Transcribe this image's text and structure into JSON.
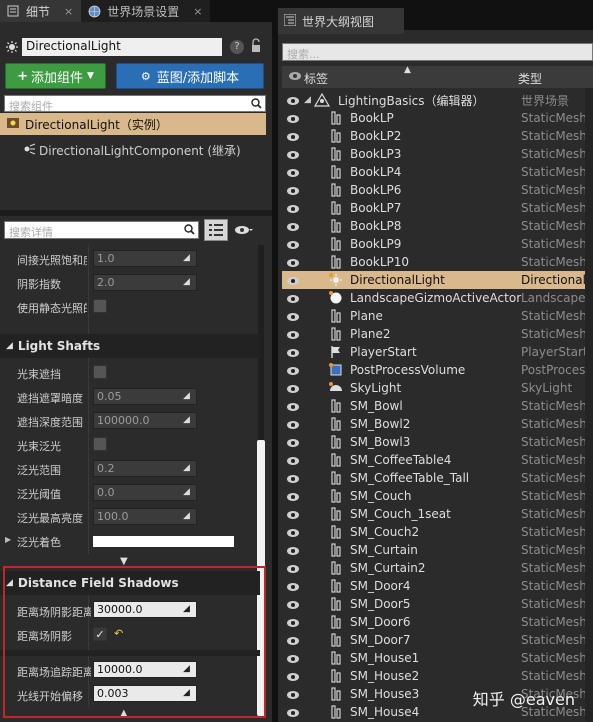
{
  "left_panel": {
    "tabs": [
      {
        "label": "细节",
        "icon": "details-icon",
        "close": "×"
      },
      {
        "label": "世界场景设置",
        "icon": "globe-icon",
        "close": "×"
      }
    ],
    "actor_name": "DirectionalLight",
    "add_component_label": "添加组件",
    "blueprint_label": "蓝图/添加脚本",
    "search_components_placeholder": "搜索组件",
    "components": {
      "root": "DirectionalLight（实例）",
      "child": "DirectionalLightComponent (继承)"
    },
    "search_details_placeholder": "搜索详情",
    "properties_top": [
      {
        "label": "间接光照饱和度",
        "value": "1.0"
      },
      {
        "label": "阴影指数",
        "value": "2.0"
      },
      {
        "label": "使用静态光照的阴影",
        "checkbox": false
      }
    ],
    "light_shafts": {
      "title": "Light Shafts",
      "rows": [
        {
          "label": "光束遮挡",
          "checkbox": false
        },
        {
          "label": "遮挡遮罩暗度",
          "value": "0.05"
        },
        {
          "label": "遮挡深度范围",
          "value": "100000.0"
        },
        {
          "label": "光束泛光",
          "checkbox": false
        },
        {
          "label": "泛光范围",
          "value": "0.2"
        },
        {
          "label": "泛光阈值",
          "value": "0.0"
        },
        {
          "label": "泛光最高亮度",
          "value": "100.0"
        },
        {
          "label": "泛光着色",
          "color": "#ffffff"
        }
      ]
    },
    "distance_field": {
      "title": "Distance Field Shadows",
      "rows": [
        {
          "label": "距离场阴影距离",
          "value": "30000.0"
        },
        {
          "label": "距离场阴影",
          "checkbox": true
        },
        {
          "label": "距离场追踪距离",
          "value": "10000.0"
        },
        {
          "label": "光线开始偏移",
          "value": "0.003"
        }
      ]
    }
  },
  "right_panel": {
    "tab_label": "世界大纲视图",
    "search_placeholder": "搜索...",
    "col_label": "标签",
    "col_type": "类型",
    "root": {
      "name": "LightingBasics（编辑器）",
      "type": "世界场景"
    },
    "items": [
      {
        "name": "BookLP",
        "type": "StaticMeshActor",
        "icon": "mesh-icon"
      },
      {
        "name": "BookLP2",
        "type": "StaticMeshActor",
        "icon": "mesh-icon"
      },
      {
        "name": "BookLP3",
        "type": "StaticMeshActor",
        "icon": "mesh-icon"
      },
      {
        "name": "BookLP4",
        "type": "StaticMeshActor",
        "icon": "mesh-icon"
      },
      {
        "name": "BookLP6",
        "type": "StaticMeshActor",
        "icon": "mesh-icon"
      },
      {
        "name": "BookLP7",
        "type": "StaticMeshActor",
        "icon": "mesh-icon"
      },
      {
        "name": "BookLP8",
        "type": "StaticMeshActor",
        "icon": "mesh-icon"
      },
      {
        "name": "BookLP9",
        "type": "StaticMeshActor",
        "icon": "mesh-icon"
      },
      {
        "name": "BookLP10",
        "type": "StaticMeshActor",
        "icon": "mesh-icon"
      },
      {
        "name": "DirectionalLight",
        "type": "DirectionalLight",
        "icon": "sun-icon",
        "selected": true
      },
      {
        "name": "LandscapeGizmoActiveActor",
        "type": "LandscapeGizmo",
        "icon": "sphere-icon"
      },
      {
        "name": "Plane",
        "type": "StaticMeshActor",
        "icon": "mesh-icon"
      },
      {
        "name": "Plane2",
        "type": "StaticMeshActor",
        "icon": "mesh-icon"
      },
      {
        "name": "PlayerStart",
        "type": "PlayerStart",
        "icon": "flag-icon"
      },
      {
        "name": "PostProcessVolume",
        "type": "PostProcessVolume",
        "icon": "volume-icon"
      },
      {
        "name": "SkyLight",
        "type": "SkyLight",
        "icon": "skylight-icon"
      },
      {
        "name": "SM_Bowl",
        "type": "StaticMeshActor",
        "icon": "mesh-icon"
      },
      {
        "name": "SM_Bowl2",
        "type": "StaticMeshActor",
        "icon": "mesh-icon"
      },
      {
        "name": "SM_Bowl3",
        "type": "StaticMeshActor",
        "icon": "mesh-icon"
      },
      {
        "name": "SM_CoffeeTable4",
        "type": "StaticMeshActor",
        "icon": "mesh-icon"
      },
      {
        "name": "SM_CoffeeTable_Tall",
        "type": "StaticMeshActor",
        "icon": "mesh-icon"
      },
      {
        "name": "SM_Couch",
        "type": "StaticMeshActor",
        "icon": "mesh-icon"
      },
      {
        "name": "SM_Couch_1seat",
        "type": "StaticMeshActor",
        "icon": "mesh-icon"
      },
      {
        "name": "SM_Couch2",
        "type": "StaticMeshActor",
        "icon": "mesh-icon"
      },
      {
        "name": "SM_Curtain",
        "type": "StaticMeshActor",
        "icon": "mesh-icon"
      },
      {
        "name": "SM_Curtain2",
        "type": "StaticMeshActor",
        "icon": "mesh-icon"
      },
      {
        "name": "SM_Door4",
        "type": "StaticMeshActor",
        "icon": "mesh-icon"
      },
      {
        "name": "SM_Door5",
        "type": "StaticMeshActor",
        "icon": "mesh-icon"
      },
      {
        "name": "SM_Door6",
        "type": "StaticMeshActor",
        "icon": "mesh-icon"
      },
      {
        "name": "SM_Door7",
        "type": "StaticMeshActor",
        "icon": "mesh-icon"
      },
      {
        "name": "SM_House1",
        "type": "StaticMeshActor",
        "icon": "mesh-icon"
      },
      {
        "name": "SM_House2",
        "type": "StaticMeshActor",
        "icon": "mesh-icon"
      },
      {
        "name": "SM_House3",
        "type": "StaticMeshActor",
        "icon": "mesh-icon"
      },
      {
        "name": "SM_House4",
        "type": "StaticMeshActor",
        "icon": "mesh-icon"
      }
    ]
  },
  "watermark": "知乎 @eaven",
  "colors": {
    "selection": "#d9b88b",
    "add_button": "#3d9b41",
    "blueprint_button": "#2a6fb6",
    "highlight_border": "#c0272d"
  }
}
